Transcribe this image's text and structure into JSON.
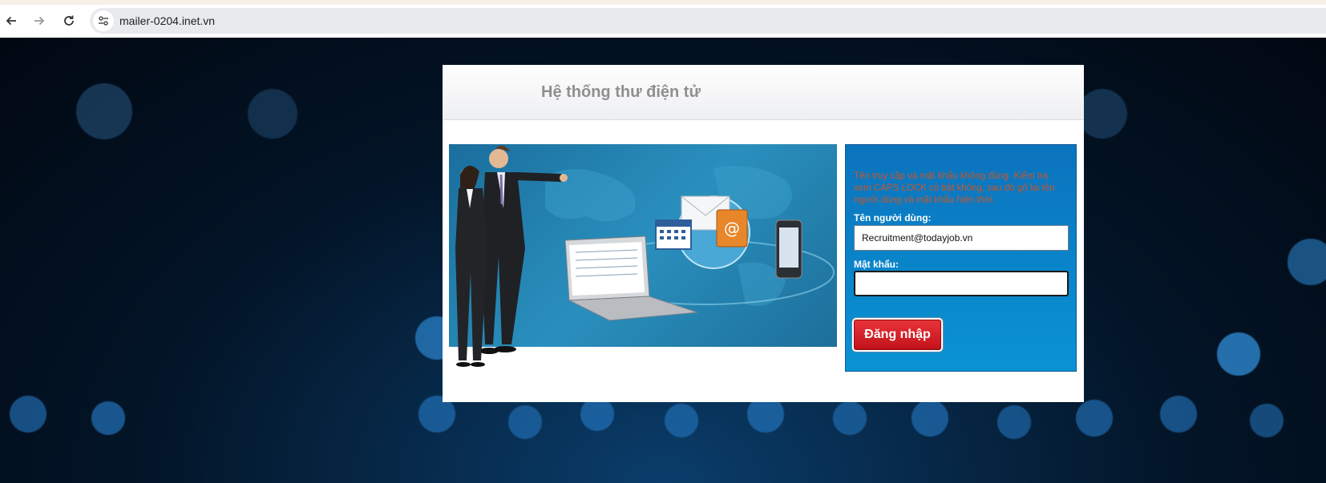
{
  "browser": {
    "url": "mailer-0204.inet.vn",
    "back_icon": "back-arrow-icon",
    "forward_icon": "forward-arrow-icon",
    "reload_icon": "reload-icon",
    "site_info_icon": "site-info-icon"
  },
  "page": {
    "title": "Hệ thống thư điện tử",
    "illustration": "email-system-illustration"
  },
  "login": {
    "error_message": "Tên truy cập và mật khẩu không đúng. Kiểm tra xem CAPS LOCK có bật không, sau đó gõ lại tên người dùng và mật khẩu hiện thời.",
    "username_label": "Tên người dùng:",
    "username_value": "Recruitment@todayjob.vn",
    "password_label": "Mật khẩu:",
    "password_value": "",
    "submit_label": "Đăng nhập"
  },
  "colors": {
    "login_box": "#0a86cc",
    "button": "#d11a22",
    "error": "#c8562a",
    "title": "#8f8f8f"
  }
}
